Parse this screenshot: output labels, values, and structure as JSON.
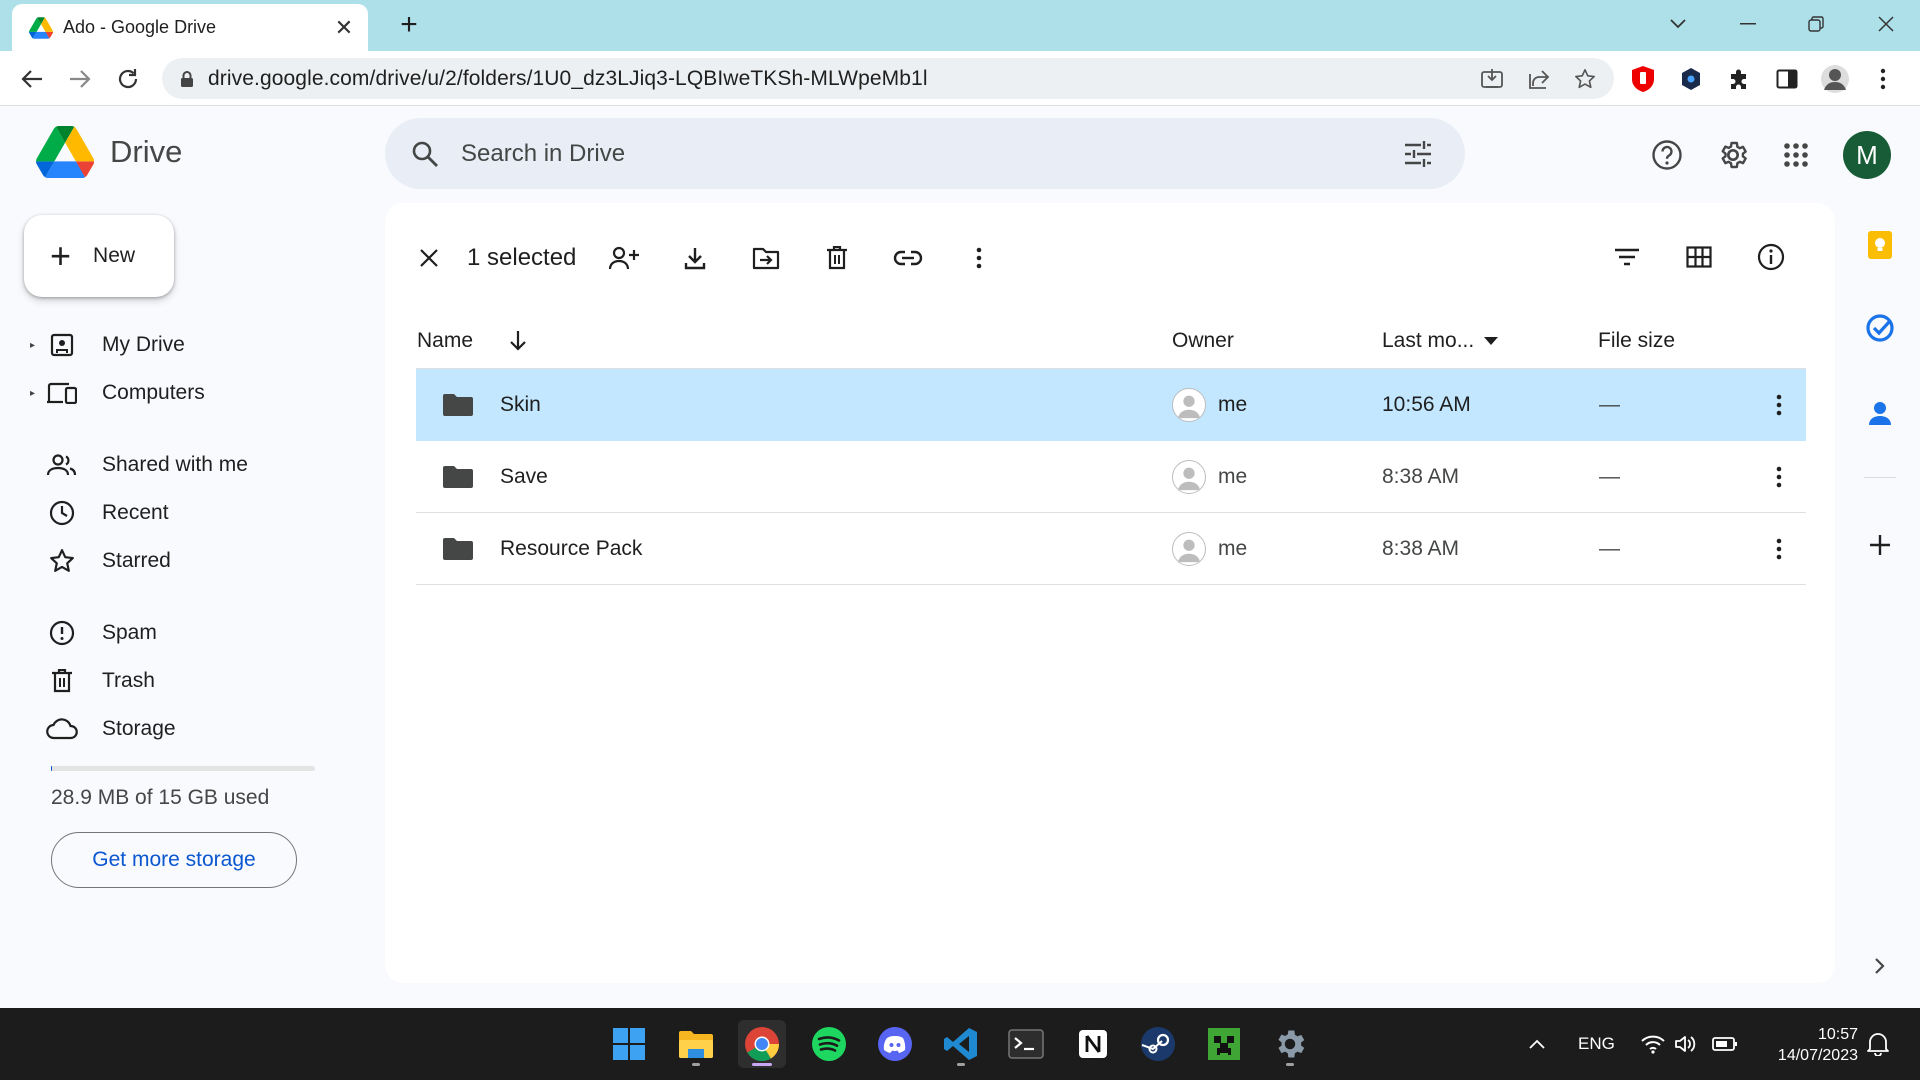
{
  "browser": {
    "tab_title": "Ado - Google Drive",
    "url": "drive.google.com/drive/u/2/folders/1U0_dz3LJiq3-LQBIweTKSh-MLWpeMb1l"
  },
  "drive": {
    "logo_text": "Drive",
    "search_placeholder": "Search in Drive",
    "avatar_letter": "M"
  },
  "sidebar": {
    "new_label": "New",
    "items": [
      {
        "label": "My Drive"
      },
      {
        "label": "Computers"
      },
      {
        "label": "Shared with me"
      },
      {
        "label": "Recent"
      },
      {
        "label": "Starred"
      },
      {
        "label": "Spam"
      },
      {
        "label": "Trash"
      },
      {
        "label": "Storage"
      }
    ],
    "storage_text": "28.9 MB of 15 GB used",
    "storage_fraction": 0.002,
    "get_storage_label": "Get more storage"
  },
  "actionbar": {
    "selected_text": "1 selected"
  },
  "table": {
    "columns": {
      "name": "Name",
      "owner": "Owner",
      "modified": "Last mo...",
      "size": "File size"
    },
    "rows": [
      {
        "name": "Skin",
        "owner": "me",
        "modified": "10:56 AM",
        "size": "—",
        "selected": true
      },
      {
        "name": "Save",
        "owner": "me",
        "modified": "8:38 AM",
        "size": "—",
        "selected": false
      },
      {
        "name": "Resource Pack",
        "owner": "me",
        "modified": "8:38 AM",
        "size": "—",
        "selected": false
      }
    ]
  },
  "taskbar": {
    "language": "ENG",
    "time": "10:57",
    "date": "14/07/2023"
  },
  "colors": {
    "selected_row": "#c2e7ff",
    "accent": "#0b57d0",
    "avatar_bg": "#185c37",
    "search_bg": "#e9eef6"
  }
}
